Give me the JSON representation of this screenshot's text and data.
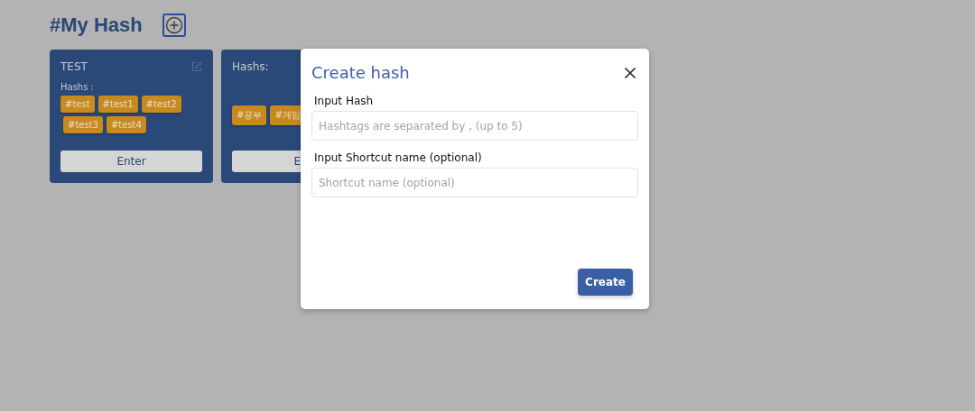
{
  "header": {
    "title": "#My Hash"
  },
  "cards": [
    {
      "title": "TEST",
      "hashs_label": "Hashs :",
      "tags": [
        "#test",
        "#test1",
        "#test2",
        "#test3",
        "#test4"
      ],
      "button": "Enter"
    },
    {
      "hashs_label": "Hashs:",
      "tags": [
        "#공부",
        "#게임"
      ],
      "button": "E"
    }
  ],
  "modal": {
    "title": "Create hash",
    "fields": [
      {
        "label": "Input Hash",
        "placeholder": "Hashtags are separated by , (up to 5)"
      },
      {
        "label": "Input Shortcut name (optional)",
        "placeholder": "Shortcut name (optional)"
      }
    ],
    "button": "Create"
  }
}
